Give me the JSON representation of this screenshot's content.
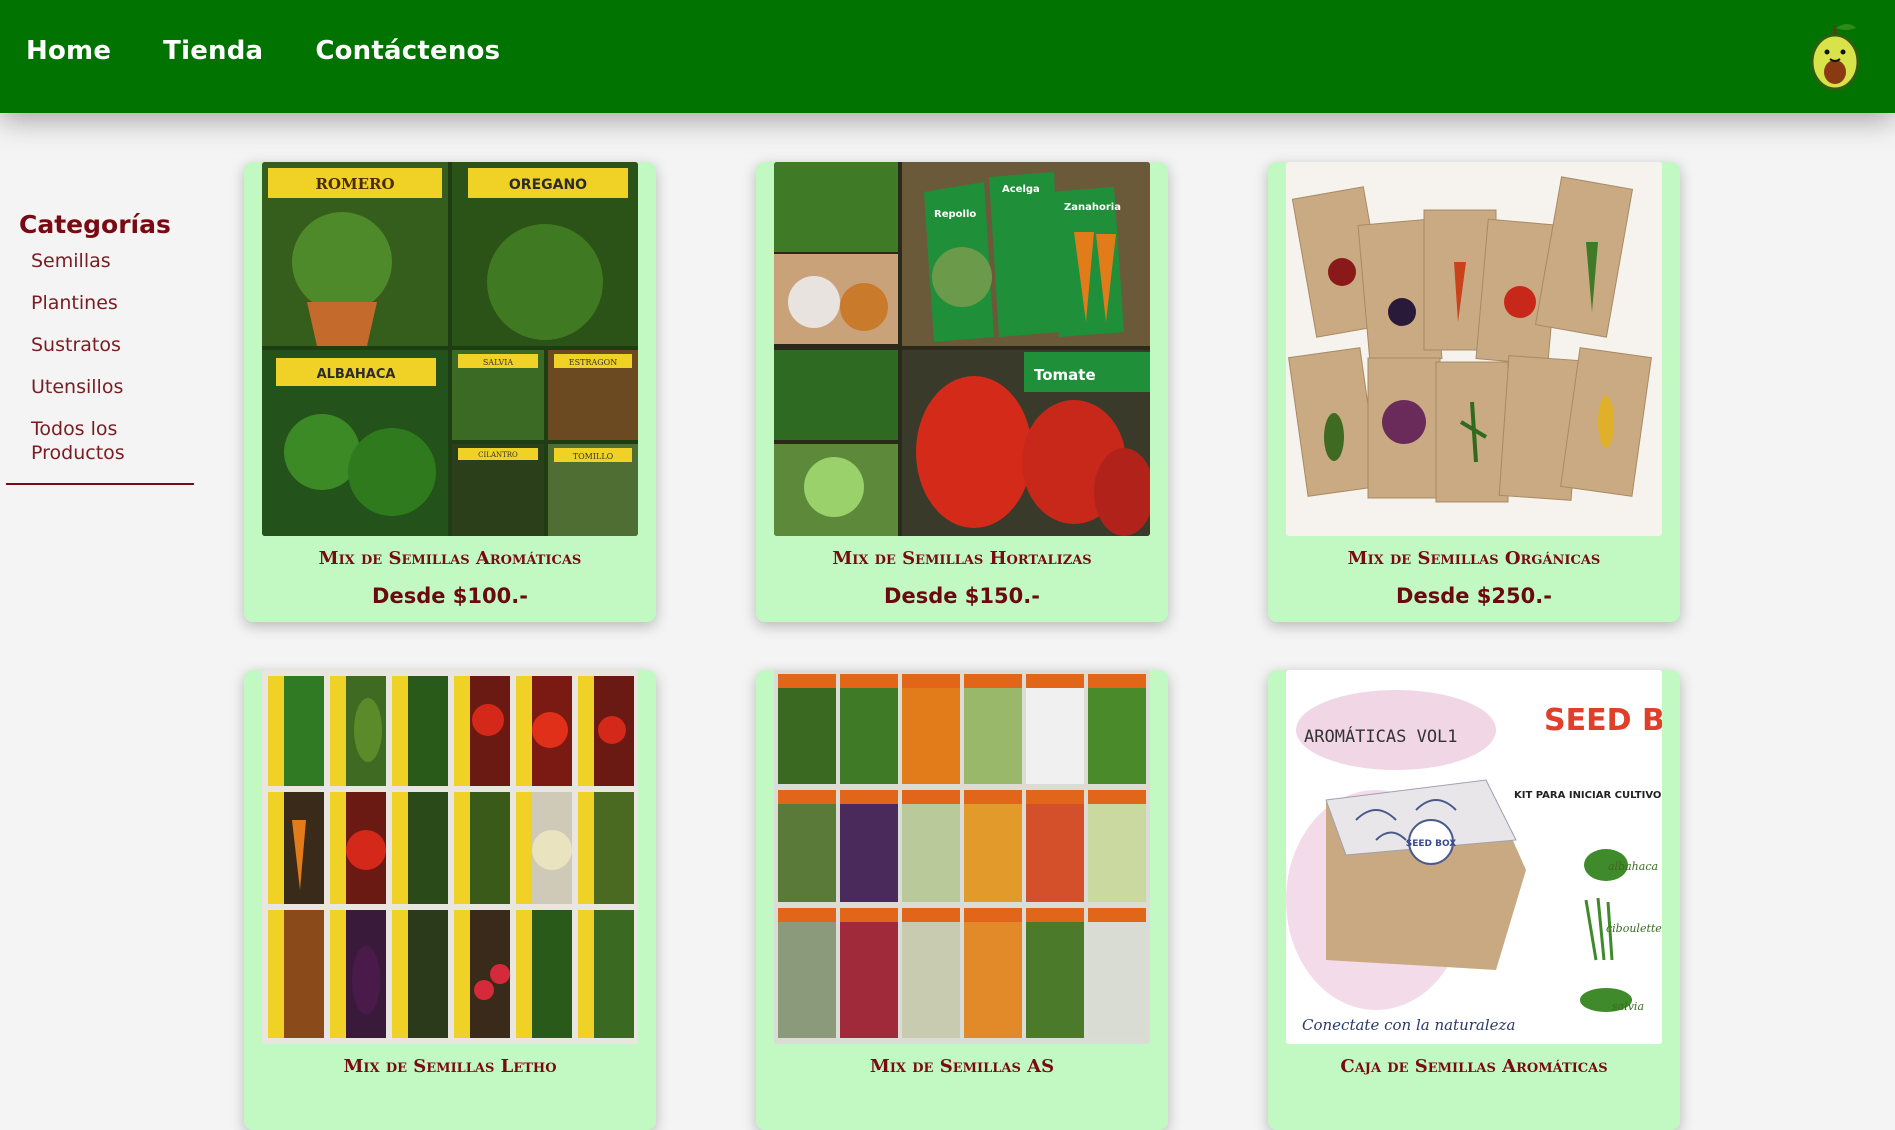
{
  "nav": {
    "home": "Home",
    "tienda": "Tienda",
    "contacto": "Contáctenos"
  },
  "sidebar": {
    "title": "Categorías",
    "items": [
      "Semillas",
      "Plantines",
      "Sustratos",
      "Utensillos",
      "Todos los Productos"
    ]
  },
  "products": [
    {
      "title": "Mix de Semillas Aromáticas",
      "price": "Desde $100.-",
      "image_labels": [
        "ROMERO",
        "OREGANO",
        "ALBAHACA",
        "SALVIA",
        "ESTRAGON",
        "CILANTRO",
        "TOMILLO"
      ]
    },
    {
      "title": "Mix de Semillas Hortalizas",
      "price": "Desde $150.-",
      "image_labels": [
        "Repollo",
        "Acelga",
        "Zanahoria",
        "Tomate"
      ]
    },
    {
      "title": "Mix de Semillas Orgánicas",
      "price": "Desde $250.-"
    },
    {
      "title": "Mix de Semillas Letho",
      "price": ""
    },
    {
      "title": "Mix de Semillas AS",
      "price": ""
    },
    {
      "title": "Caja de Semillas Aromáticas",
      "price": "",
      "image_labels": [
        "AROMÁTICAS VOL1",
        "SEED BOX",
        "KIT PARA INICIAR CULTIVOS",
        "SEED BOX",
        "albahaca",
        "ciboulette",
        "salvia",
        "Conectate con la naturaleza"
      ]
    }
  ],
  "colors": {
    "header": "#007300",
    "card": "#c2f9c2",
    "accent": "#7a0a12"
  }
}
